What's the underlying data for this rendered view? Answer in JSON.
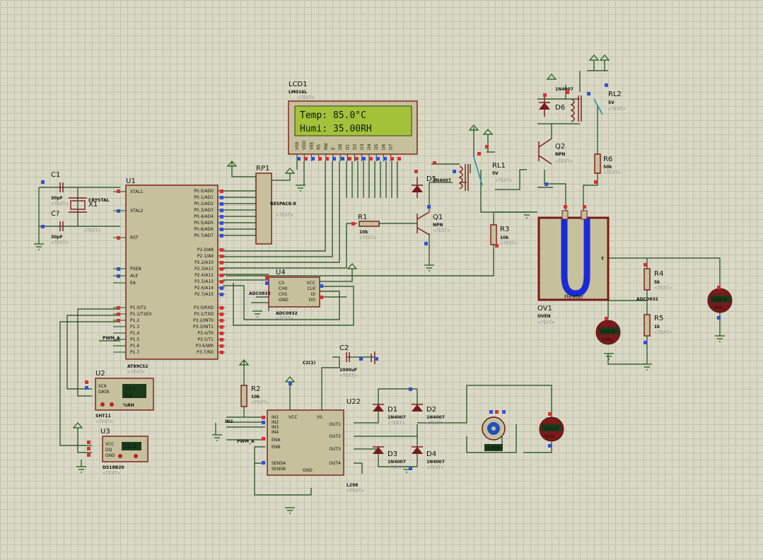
{
  "lcd": {
    "ref": "LCD1",
    "model": "LM016L",
    "line1": "Temp: 85.0°C",
    "line2": "Humi: 35.00RH",
    "pins": [
      "VSS",
      "VDD",
      "VEE",
      "RS",
      "RW",
      "E",
      "D0",
      "D1",
      "D2",
      "D3",
      "D4",
      "D5",
      "D6",
      "D7"
    ]
  },
  "mcu": {
    "ref": "U1",
    "model": "AT89C52",
    "left_pins": [
      "XTAL1",
      "XTAL2",
      "RST",
      "PSEN",
      "ALE",
      "EA",
      "P1.0/T2",
      "P1.1/T2EX",
      "P1.2",
      "P1.3",
      "P1.4",
      "P1.5",
      "P1.6",
      "P1.7"
    ],
    "right_pins": [
      "P0.0/AD0",
      "P0.1/AD1",
      "P0.2/AD2",
      "P0.3/AD3",
      "P0.4/AD4",
      "P0.5/AD5",
      "P0.6/AD6",
      "P0.7/AD7",
      "P2.0/A8",
      "P2.1/A9",
      "P2.2/A10",
      "P2.3/A11",
      "P2.4/A12",
      "P2.5/A13",
      "P2.6/A14",
      "P2.7/A15",
      "P3.0/RXD",
      "P3.1/TXD",
      "P3.2/INT0",
      "P3.3/INT1",
      "P3.4/T0",
      "P3.5/T1",
      "P3.6/WR",
      "P3.7/RD"
    ]
  },
  "crystal": {
    "c1": "C1",
    "c1v": "30pF",
    "c2": "C?",
    "c2v": "30pF",
    "x": "X1",
    "xv": "CRYSTAL"
  },
  "rp1": {
    "ref": "RP1",
    "model": "RESPACK-8"
  },
  "adc": {
    "ref": "U4",
    "model": "ADC0832",
    "pins": [
      "CS",
      "CH0",
      "CH1",
      "GND",
      "VCC",
      "CLK",
      "DI",
      "DO"
    ],
    "label": "ADC0832"
  },
  "sht": {
    "ref": "U2",
    "model": "SHT11",
    "pins": [
      "SCK",
      "DATA"
    ],
    "temp": "33.0",
    "hum": "9.0",
    "units": "%RH"
  },
  "ds": {
    "ref": "U3",
    "model": "DS18B20",
    "pins": [
      "VCC",
      "DQ",
      "GND"
    ],
    "reading": "22.0"
  },
  "q1": {
    "ref": "Q1",
    "type": "NPN"
  },
  "q2": {
    "ref": "Q2",
    "type": "NPN"
  },
  "r1": {
    "ref": "R1",
    "val": "10k"
  },
  "r2": {
    "ref": "R2",
    "val": "10k"
  },
  "r3": {
    "ref": "R3",
    "val": "10k"
  },
  "r4": {
    "ref": "R4",
    "val": "5k"
  },
  "r5": {
    "ref": "R5",
    "val": "1k"
  },
  "r6": {
    "ref": "R6",
    "val": "50k"
  },
  "d5": {
    "ref": "D5",
    "model": "1N4007"
  },
  "d6": {
    "ref": "D6",
    "model": "1N4007"
  },
  "rl1": {
    "ref": "RL1",
    "val": "5V"
  },
  "rl2": {
    "ref": "RL2",
    "val": "5V"
  },
  "oven": {
    "ref": "OV1",
    "model": "OVEN",
    "heater": "Heater",
    "t_pin": "T"
  },
  "l298": {
    "ref": "U22",
    "model": "L298",
    "left_pins": [
      "IN1",
      "IN2",
      "IN3",
      "IN4",
      "ENA",
      "ENB",
      "SENSA",
      "SENSB"
    ],
    "vcc": "VCC",
    "vs": "VS",
    "gnd": "GND",
    "outs": [
      "OUT1",
      "OUT2",
      "OUT3",
      "OUT4"
    ]
  },
  "c2": {
    "ref": "C2",
    "val": "1000uF",
    "probe": "C2(1)"
  },
  "bridge": {
    "d1": "D1",
    "d2": "D2",
    "d3": "D3",
    "d4": "D4",
    "model": "1N4007"
  },
  "motor": {
    "reading": "+298"
  },
  "meters": {
    "m1": "+21.0",
    "m2": "+27.0",
    "m3": "+29.4",
    "m4": "+20.4",
    "unit": "Volts"
  },
  "nets": {
    "pwm": "PWM_A",
    "in2": "IN2"
  },
  "text_placeholder": "<TEXT>"
}
